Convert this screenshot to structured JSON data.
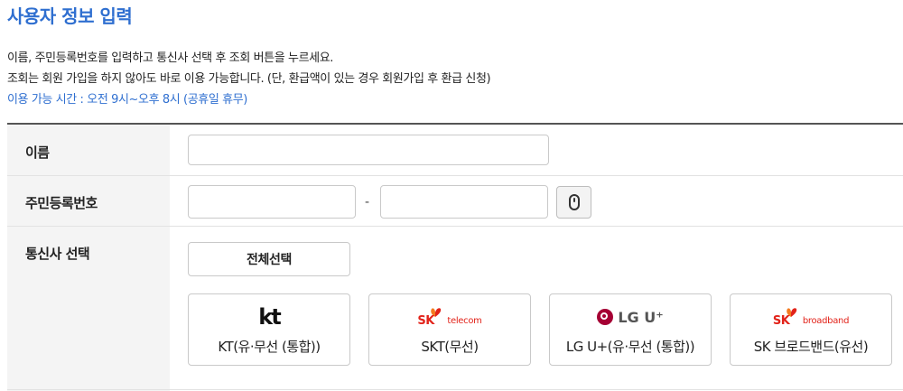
{
  "header": {
    "title": "사용자 정보 입력",
    "desc1": "이름, 주민등록번호를 입력하고 통신사 선택 후 조회 버튼을 누르세요.",
    "desc2": "조회는 회원 가입을 하지 않아도 바로 이용 가능합니다. (단, 환급액이 있는 경우 회원가입 후 환급 신청)",
    "hours": "이용 가능 시간 : 오전 9시~오후 8시 (공휴일 휴무)"
  },
  "form": {
    "name_label": "이름",
    "name_value": "",
    "rrn_label": "주민등록번호",
    "rrn_front_value": "",
    "rrn_separator": "-",
    "rrn_back_value": "",
    "keypad_icon": "mouse-icon",
    "carrier_label": "통신사 선택",
    "select_all_label": "전체선택"
  },
  "carriers": [
    {
      "name": "KT(유·무선 (통합))",
      "logo_text": "kt"
    },
    {
      "name": "SKT(무선)",
      "logo_text": "SK",
      "logo_sub": "telecom"
    },
    {
      "name": "LG U+(유·무선 (통합))",
      "logo_text": "LG U⁺"
    },
    {
      "name": "SK 브로드밴드(유선)",
      "logo_text": "SK",
      "logo_sub": "broadband"
    }
  ],
  "colors": {
    "accent": "#2f6fd0",
    "sk_red": "#e2231a",
    "sk_orange": "#f47b20",
    "lg_magenta": "#a50034"
  }
}
